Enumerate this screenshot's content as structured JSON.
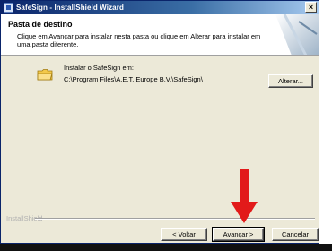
{
  "window": {
    "title": "SafeSign - InstallShield Wizard",
    "close_glyph": "×"
  },
  "header": {
    "title": "Pasta de destino",
    "description": "Clique em Avançar para instalar nesta pasta ou clique em Alterar para instalar em uma pasta diferente."
  },
  "main": {
    "install_label": "Instalar o SafeSign em:",
    "install_path": "C:\\Program Files\\A.E.T. Europe B.V.\\SafeSign\\",
    "change_button": "Alterar..."
  },
  "footer": {
    "brand": "InstallShield",
    "back_button": "< Voltar",
    "next_button": "Avançar >",
    "cancel_button": "Cancelar"
  },
  "colors": {
    "annotation_arrow": "#e21a1a",
    "titlebar": "#0a246a"
  },
  "icons": [
    "app-icon",
    "folder-icon",
    "close-icon",
    "annotation-arrow"
  ]
}
